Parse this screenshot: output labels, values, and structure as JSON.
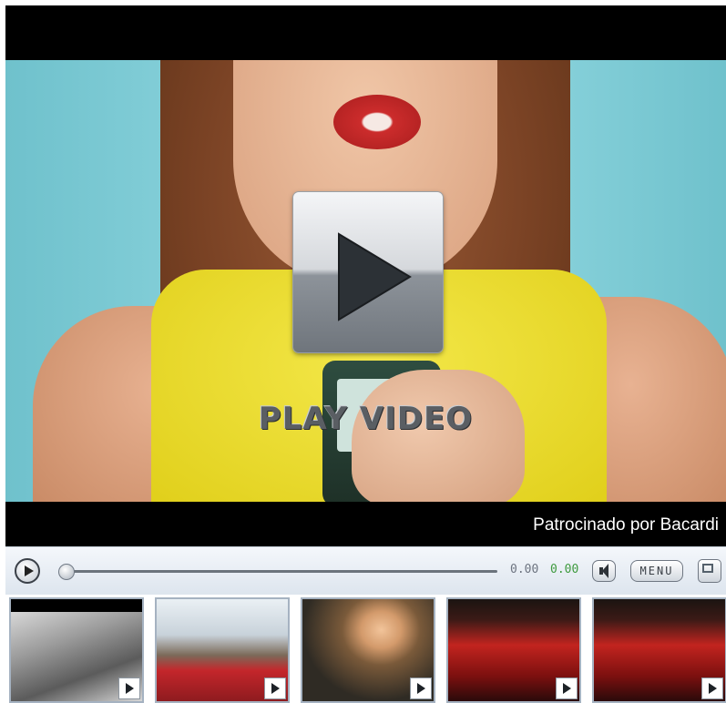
{
  "video": {
    "play_overlay_label": "PLAY VIDEO",
    "sponsor_text": "Patrocinado por Bacardi"
  },
  "controls": {
    "elapsed": "0.00",
    "total": "0.00",
    "menu_label": "MENU",
    "progress": 0
  },
  "thumbnails": [
    {
      "icon": "play-icon"
    },
    {
      "icon": "play-icon"
    },
    {
      "icon": "play-icon"
    },
    {
      "icon": "play-icon"
    },
    {
      "icon": "play-icon"
    }
  ],
  "colors": {
    "time_elapsed": "#6d7480",
    "time_total": "#3e9a3e",
    "thumbnail_border": "#a5b2c1"
  }
}
